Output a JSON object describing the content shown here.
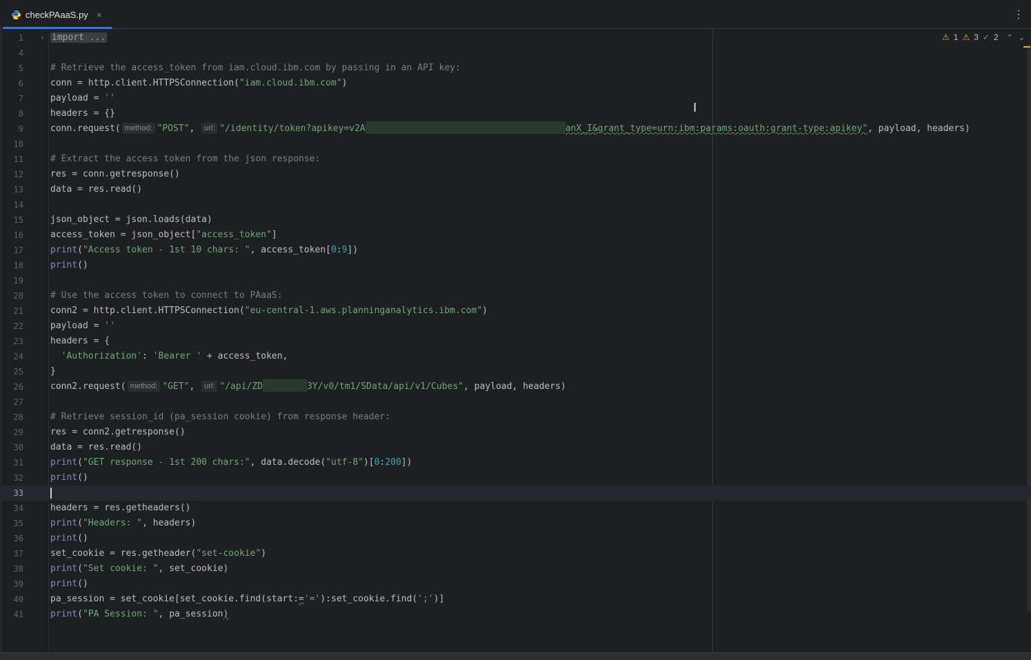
{
  "tab": {
    "filename": "checkPAaaS.py",
    "close": "×"
  },
  "menu": {
    "kebab": "⋮"
  },
  "inspections": {
    "warn_a": "1",
    "warn_b": "3",
    "ok": "2"
  },
  "hints": {
    "method": "method:",
    "url": "url:",
    "start": "start:"
  },
  "lines": {
    "l1": {
      "n": "1",
      "folded": "import ..."
    },
    "l4": {
      "n": "4"
    },
    "l5": {
      "n": "5",
      "comment": "# Retrieve the access_token from iam.cloud.ibm.com by passing in an API key:"
    },
    "l6": {
      "n": "6",
      "a": "conn = http.client.HTTPSConnection(",
      "s": "\"iam.cloud.ibm.com\"",
      "b": ")"
    },
    "l7": {
      "n": "7",
      "a": "payload = ",
      "s": "''"
    },
    "l8": {
      "n": "8",
      "a": "headers = {}"
    },
    "l9": {
      "n": "9",
      "a": "conn.request(",
      "s1": "\"POST\"",
      "b": ", ",
      "s2a": "\"/identity/token?apikey=v2A",
      "s2b": "anX_I&grant_type=urn:ibm:params:oauth:grant-type:apikey\"",
      "c": ", payload, headers)"
    },
    "l10": {
      "n": "10"
    },
    "l11": {
      "n": "11",
      "comment": "# Extract the access token from the json response:"
    },
    "l12": {
      "n": "12",
      "a": "res = conn.getresponse()"
    },
    "l13": {
      "n": "13",
      "a": "data = res.read()"
    },
    "l14": {
      "n": "14"
    },
    "l15": {
      "n": "15",
      "a": "json_object = json.loads(data)"
    },
    "l16": {
      "n": "16",
      "a": "access_token = json_object[",
      "s": "\"access_token\"",
      "b": "]"
    },
    "l17": {
      "n": "17",
      "fn": "print",
      "a": "(",
      "s": "\"Access token - 1st 10 chars: \"",
      "b": ", access_token[",
      "n1": "0",
      "c": ":",
      "n2": "9",
      "d": "])"
    },
    "l18": {
      "n": "18",
      "fn": "print",
      "a": "()"
    },
    "l19": {
      "n": "19"
    },
    "l20": {
      "n": "20",
      "comment": "# Use the access token to connect to PAaaS:"
    },
    "l21": {
      "n": "21",
      "a": "conn2 = http.client.HTTPSConnection(",
      "s": "\"eu-central-1.aws.planninganalytics.ibm.com\"",
      "b": ")"
    },
    "l22": {
      "n": "22",
      "a": "payload = ",
      "s": "''"
    },
    "l23": {
      "n": "23",
      "a": "headers = {"
    },
    "l24": {
      "n": "24",
      "ind": "  ",
      "s1": "'Authorization'",
      "a": ": ",
      "s2": "'Bearer '",
      "b": " + access_token,"
    },
    "l25": {
      "n": "25",
      "a": "}"
    },
    "l26": {
      "n": "26",
      "a": "conn2.request(",
      "s1": "\"GET\"",
      "b": ", ",
      "s2a": "\"/api/ZD",
      "s2b": "3Y/v0/tm1/SData/api/v1/Cubes\"",
      "c": ", payload, headers)"
    },
    "l27": {
      "n": "27"
    },
    "l28": {
      "n": "28",
      "comment": "# Retrieve session_id (pa_session cookie) from response header:"
    },
    "l29": {
      "n": "29",
      "a": "res = conn2.getresponse()"
    },
    "l30": {
      "n": "30",
      "a": "data = res.read()"
    },
    "l31": {
      "n": "31",
      "fn": "print",
      "a": "(",
      "s": "\"GET response - 1st 200 chars:\"",
      "b": ", data.decode(",
      "s2": "\"utf-8\"",
      "c": ")[",
      "n1": "0",
      "d": ":",
      "n2": "200",
      "e": "])"
    },
    "l32": {
      "n": "32",
      "fn": "print",
      "a": "()"
    },
    "l33": {
      "n": "33"
    },
    "l34": {
      "n": "34",
      "a": "headers = res.getheaders()"
    },
    "l35": {
      "n": "35",
      "fn": "print",
      "a": "(",
      "s": "\"Headers: \"",
      "b": ", headers)"
    },
    "l36": {
      "n": "36",
      "fn": "print",
      "a": "()"
    },
    "l37": {
      "n": "37",
      "a": "set_cookie = res.getheader(",
      "s": "\"set-cookie\"",
      "b": ")"
    },
    "l38": {
      "n": "38",
      "fn": "print",
      "a": "(",
      "s": "\"Set cookie: \"",
      "b": ", set_cookie)"
    },
    "l39": {
      "n": "39",
      "fn": "print",
      "a": "()"
    },
    "l40": {
      "n": "40",
      "a": "pa_session = set_cookie[set_cookie.find(",
      "eq": "=",
      "s1": "'='",
      "b": "):set_cookie.find(",
      "s2": "';'",
      "c": ")]"
    },
    "l41": {
      "n": "41",
      "fn": "print",
      "a": "(",
      "s": "\"PA Session: \"",
      "b": ", pa_session",
      "c": ")"
    }
  }
}
